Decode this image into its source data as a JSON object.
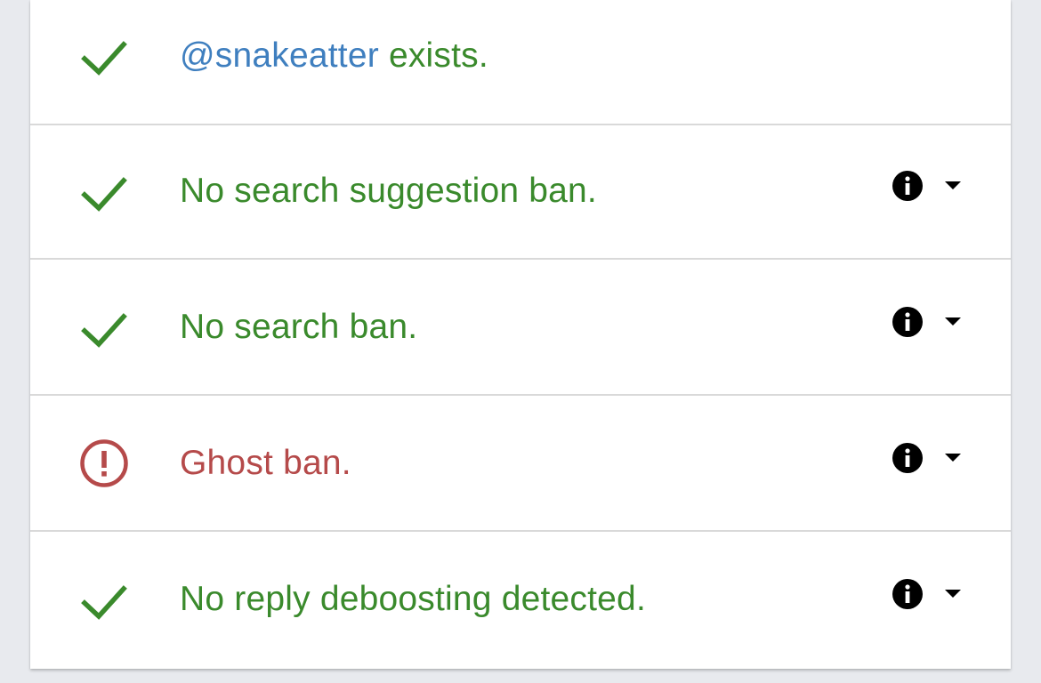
{
  "colors": {
    "success": "#3a8a2c",
    "error": "#b54a4a",
    "handle": "#3f7fbf",
    "icon": "#000000"
  },
  "rows": [
    {
      "icon": "checkmark-icon",
      "handle": "@snakeatter",
      "text": " exists.",
      "has_details": false
    },
    {
      "icon": "checkmark-icon",
      "text": "No search suggestion ban.",
      "has_details": true,
      "details_icons": [
        "info-icon",
        "caret-down-icon"
      ]
    },
    {
      "icon": "checkmark-icon",
      "text": "No search ban.",
      "has_details": true,
      "details_icons": [
        "info-icon",
        "caret-down-icon"
      ]
    },
    {
      "icon": "alert-circle-icon",
      "text": "Ghost ban.",
      "has_details": true,
      "details_icons": [
        "info-icon",
        "caret-down-icon"
      ]
    },
    {
      "icon": "checkmark-icon",
      "text": "No reply deboosting detected.",
      "has_details": true,
      "details_icons": [
        "info-icon",
        "caret-down-icon"
      ]
    }
  ]
}
